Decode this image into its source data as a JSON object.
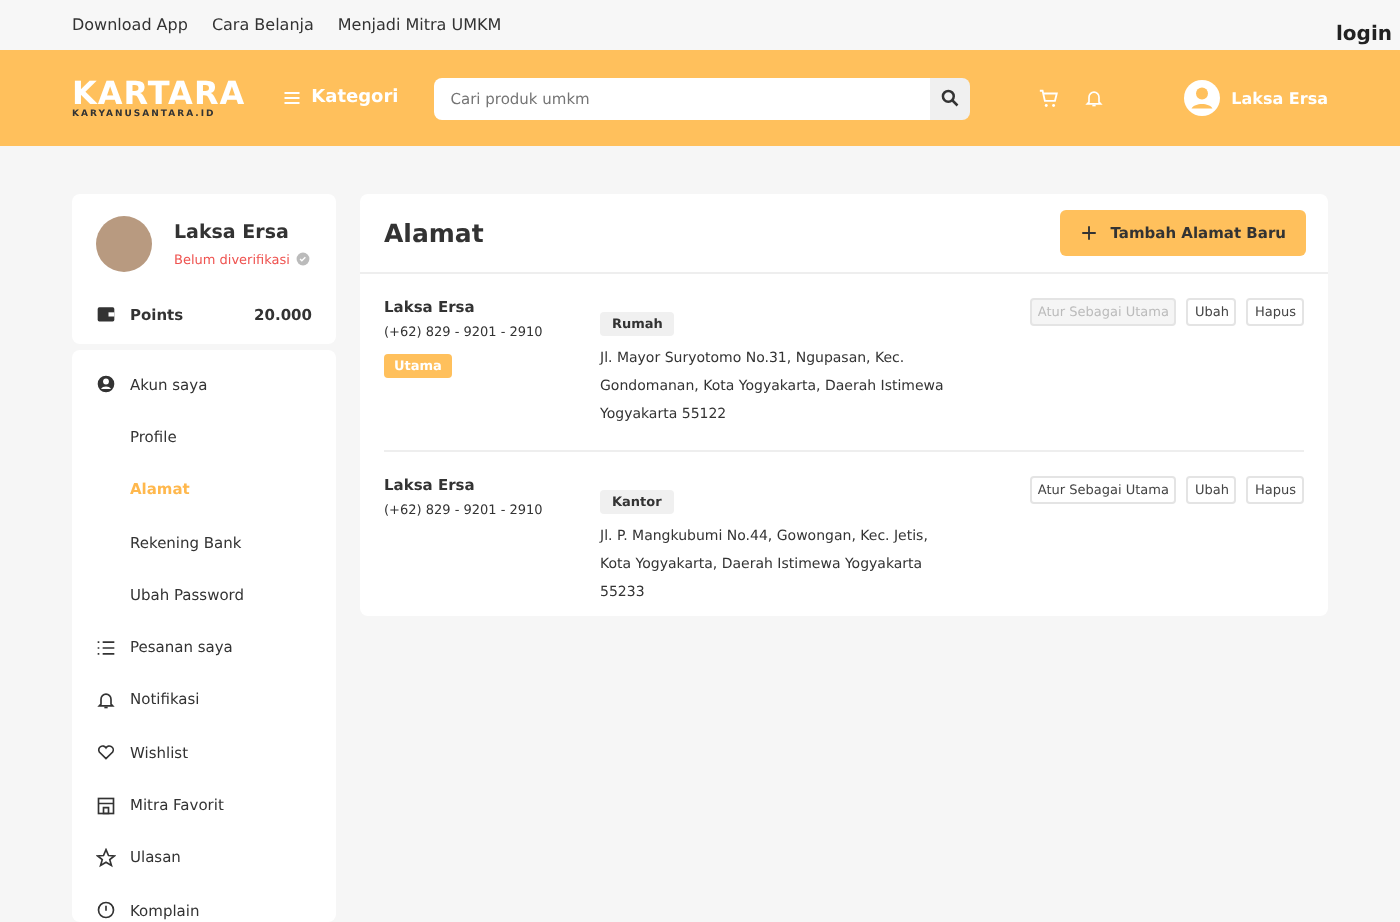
{
  "top_links": [
    "Download App",
    "Cara Belanja",
    "Menjadi Mitra UMKM"
  ],
  "login": "login",
  "header": {
    "logo": "KARTARA",
    "logo_sub": "KARYANUSANTARA.ID",
    "category": "Kategori",
    "search": {
      "placeholder": "Cari produk umkm"
    },
    "user": "Laksa Ersa"
  },
  "profile": {
    "name": "Laksa Ersa",
    "status": "Belum diverifikasi",
    "points_label": "Points",
    "points": "20.000"
  },
  "menu": [
    {
      "kind": "section",
      "label": "Akun saya",
      "selected": false
    },
    {
      "kind": "sub",
      "label": "Profile",
      "selected": false
    },
    {
      "kind": "sub",
      "label": "Alamat",
      "selected": true
    },
    {
      "kind": "sub",
      "label": "Rekening Bank",
      "selected": false
    },
    {
      "kind": "sub",
      "label": "Ubah Password",
      "selected": false
    },
    {
      "kind": "section",
      "label": "Pesanan saya",
      "selected": false
    },
    {
      "kind": "section",
      "label": "Notifikasi",
      "selected": false
    },
    {
      "kind": "section",
      "label": "Wishlist",
      "selected": false
    },
    {
      "kind": "section",
      "label": "Mitra Favorit",
      "selected": false
    },
    {
      "kind": "section",
      "label": "Ulasan",
      "selected": false
    },
    {
      "kind": "section",
      "label": "Komplain",
      "selected": false
    }
  ],
  "address_panel": {
    "title": "Alamat",
    "add_button": "Tambah Alamat Baru",
    "addresses": [
      {
        "name": "Laksa Ersa",
        "phone": "(+62) 829 - 9201 - 2910",
        "badge": "Utama",
        "tag": "Rumah",
        "address": "Jl. Mayor Suryotomo No.31, Ngupasan, Kec. Gondomanan, Kota Yogyakarta, Daerah Istimewa Yogyakarta 55122",
        "set_primary": {
          "label": "Atur Sebagai Utama",
          "disabled": true
        },
        "edit": "Ubah",
        "delete": "Hapus"
      },
      {
        "name": "Laksa Ersa",
        "phone": "(+62) 829 - 9201 - 2910",
        "tag": "Kantor",
        "address": "Jl. P. Mangkubumi No.44, Gowongan, Kec. Jetis, Kota Yogyakarta, Daerah Istimewa Yogyakarta 55233",
        "set_primary": {
          "label": "Atur Sebagai Utama",
          "disabled": false
        },
        "edit": "Ubah",
        "delete": "Hapus"
      }
    ]
  }
}
